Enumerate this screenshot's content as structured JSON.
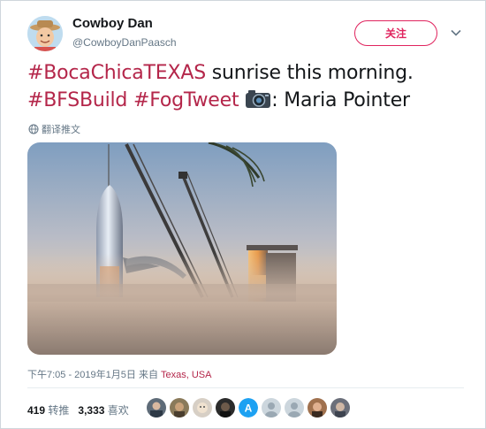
{
  "tweet": {
    "display_name": "Cowboy Dan",
    "handle": "@CowboyDanPaasch",
    "follow_label": "关注",
    "hashtag_1": "#BocaChicaTEXAS",
    "text_1": " sunrise this morning.",
    "hashtag_2": "#BFSBuild",
    "hashtag_3": "#FogTweet",
    "text_2": ": Maria Pointer",
    "translate_label": "翻译推文",
    "timestamp": "下午7:05 - 2019年1月5日 来自",
    "location": "Texas, USA"
  },
  "stats": {
    "retweets_count": "419",
    "retweets_label": "转推",
    "likes_count": "3,333",
    "likes_label": "喜欢"
  },
  "colors": {
    "hashtag": "#b4264a",
    "follow": "#e0245e",
    "muted": "#657786"
  },
  "icons": [
    "camera-icon",
    "globe-icon",
    "chevron-down-icon"
  ]
}
